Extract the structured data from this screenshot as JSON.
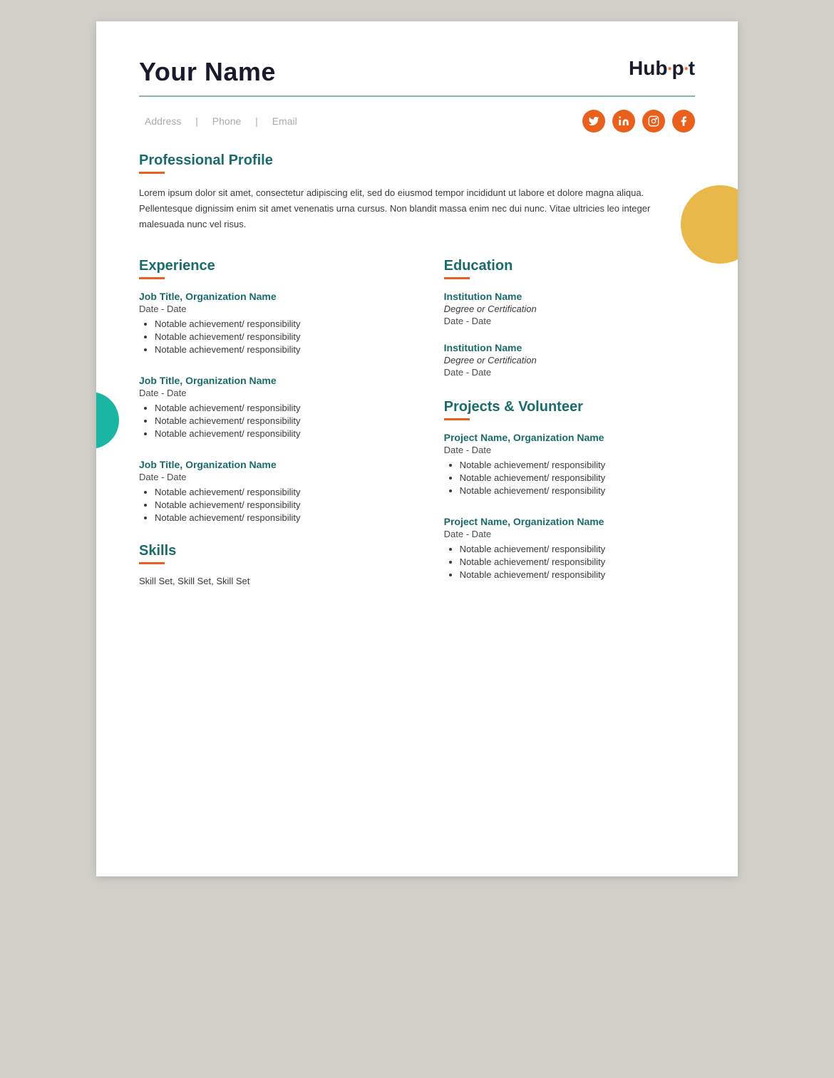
{
  "header": {
    "name": "Your Name",
    "hubspot_label": "HubSpot"
  },
  "contact": {
    "address": "Address",
    "separator1": "|",
    "phone": "Phone",
    "separator2": "|",
    "email": "Email"
  },
  "social": {
    "twitter": "🐦",
    "linkedin": "in",
    "instagram": "📷",
    "facebook": "f"
  },
  "profile": {
    "section_title": "Professional Profile",
    "text": "Lorem ipsum dolor sit amet, consectetur adipiscing elit, sed do eiusmod tempor incididunt ut labore et dolore magna aliqua. Pellentesque dignissim enim sit amet venenatis urna cursus. Non blandit massa enim nec dui nunc. Vitae ultricies leo integer malesuada nunc vel risus."
  },
  "experience": {
    "section_title": "Experience",
    "jobs": [
      {
        "title": "Job Title, Organization Name",
        "date": "Date - Date",
        "bullets": [
          "Notable achievement/ responsibility",
          "Notable achievement/ responsibility",
          "Notable achievement/ responsibility"
        ]
      },
      {
        "title": "Job Title, Organization Name",
        "date": "Date - Date",
        "bullets": [
          "Notable achievement/ responsibility",
          "Notable achievement/ responsibility",
          "Notable achievement/ responsibility"
        ]
      },
      {
        "title": "Job Title, Organization Name",
        "date": "Date - Date",
        "bullets": [
          "Notable achievement/ responsibility",
          "Notable achievement/ responsibility",
          "Notable achievement/ responsibility"
        ]
      }
    ]
  },
  "skills": {
    "section_title": "Skills",
    "text": "Skill Set, Skill Set, Skill Set"
  },
  "education": {
    "section_title": "Education",
    "items": [
      {
        "name": "Institution Name",
        "degree": "Degree or Certification",
        "date": "Date - Date"
      },
      {
        "name": "Institution Name",
        "degree": "Degree or Certification",
        "date": "Date - Date"
      }
    ]
  },
  "projects": {
    "section_title": "Projects & Volunteer",
    "items": [
      {
        "title": "Project Name, Organization Name",
        "date": "Date - Date",
        "bullets": [
          "Notable achievement/ responsibility",
          "Notable achievement/ responsibility",
          "Notable achievement/ responsibility"
        ]
      },
      {
        "title": "Project Name, Organization Name",
        "date": "Date - Date",
        "bullets": [
          "Notable achievement/ responsibility",
          "Notable achievement/ responsibility",
          "Notable achievement/ responsibility"
        ]
      }
    ]
  }
}
